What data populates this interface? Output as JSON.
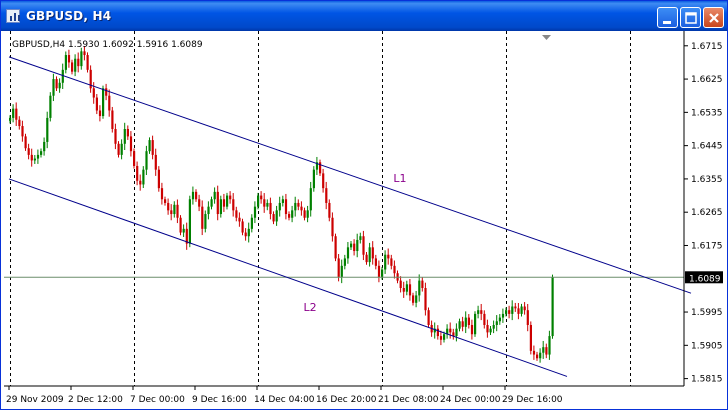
{
  "window": {
    "title": "GBPUSD, H4",
    "icon": "chart-window-icon"
  },
  "controls": {
    "minimize_icon": "minimize-icon",
    "maximize_icon": "maximize-icon",
    "close_icon": "close-icon"
  },
  "chart_data": {
    "type": "candlestick",
    "symbol": "GBPUSD",
    "timeframe": "H4",
    "info_line": "GBPUSD,H4  1.5930 1.6092 1.5916 1.6089",
    "ohlc": {
      "open": "1.5930",
      "high": "1.6092",
      "low": "1.5916",
      "close": "1.6089"
    },
    "current_price_label": "1.6089",
    "y_ticks": [
      "1.6715",
      "1.6625",
      "1.6535",
      "1.6445",
      "1.6355",
      "1.6265",
      "1.6175",
      "1.6089",
      "1.5995",
      "1.5905",
      "1.5815"
    ],
    "x_ticks": [
      "29 Nov 2009",
      "2 Dec 12:00",
      "7 Dec 00:00",
      "9 Dec 16:00",
      "14 Dec 04:00",
      "16 Dec 20:00",
      "21 Dec 08:00",
      "24 Dec 00:00",
      "29 Dec 16:00"
    ],
    "ylim": [
      1.5795,
      1.6755
    ],
    "colors": {
      "bull": "#008000",
      "bear": "#cc0000",
      "channel": "#00008b",
      "price_line": "#6b8e6b",
      "grid": "#000000",
      "bg": "#ffffff"
    },
    "period_separators": true,
    "annotations": [
      {
        "label": "L1",
        "type": "trendline",
        "p1": [
          0,
          1.6685
        ],
        "p2": [
          220,
          1.6046
        ]
      },
      {
        "label": "L2",
        "type": "trendline",
        "p1": [
          0,
          1.6355
        ],
        "p2": [
          182,
          1.5815
        ]
      }
    ],
    "candle_closes": [
      1.652,
      1.6545,
      1.6515,
      1.6498,
      1.647,
      1.6438,
      1.642,
      1.6405,
      1.641,
      1.642,
      1.643,
      1.6455,
      1.652,
      1.658,
      1.6625,
      1.66,
      1.6615,
      1.665,
      1.669,
      1.667,
      1.6645,
      1.668,
      1.666,
      1.67,
      1.669,
      1.665,
      1.66,
      1.6575,
      1.654,
      1.6525,
      1.66,
      1.658,
      1.654,
      1.649,
      1.645,
      1.642,
      1.645,
      1.649,
      1.647,
      1.643,
      1.639,
      1.635,
      1.634,
      1.638,
      1.643,
      1.646,
      1.642,
      1.638,
      1.633,
      1.63,
      1.629,
      1.627,
      1.626,
      1.6285,
      1.625,
      1.621,
      1.622,
      1.618,
      1.63,
      1.632,
      1.63,
      1.628,
      1.622,
      1.626,
      1.628,
      1.63,
      1.632,
      1.626,
      1.63,
      1.628,
      1.631,
      1.63,
      1.627,
      1.625,
      1.624,
      1.621,
      1.62,
      1.622,
      1.625,
      1.628,
      1.631,
      1.63,
      1.628,
      1.629,
      1.626,
      1.624,
      1.627,
      1.629,
      1.63,
      1.626,
      1.625,
      1.627,
      1.629,
      1.628,
      1.627,
      1.625,
      1.627,
      1.633,
      1.638,
      1.64,
      1.637,
      1.633,
      1.629,
      1.625,
      1.62,
      1.614,
      1.609,
      1.612,
      1.614,
      1.617,
      1.618,
      1.616,
      1.619,
      1.62,
      1.615,
      1.613,
      1.617,
      1.614,
      1.612,
      1.609,
      1.611,
      1.615,
      1.614,
      1.612,
      1.61,
      1.608,
      1.606,
      1.605,
      1.607,
      1.604,
      1.602,
      1.604,
      1.608,
      1.606,
      1.6,
      1.596,
      1.594,
      1.595,
      1.593,
      1.592,
      1.5935,
      1.595,
      1.594,
      1.593,
      1.595,
      1.597,
      1.5955,
      1.598,
      1.596,
      1.5935,
      1.599,
      1.6,
      1.599,
      1.596,
      1.594,
      1.595,
      1.596,
      1.597,
      1.598,
      1.599,
      1.6,
      1.599,
      1.601,
      1.6005,
      1.599,
      1.601,
      1.6,
      1.596,
      1.589,
      1.588,
      1.587,
      1.5885,
      1.59,
      1.588,
      1.593,
      1.6089
    ]
  }
}
